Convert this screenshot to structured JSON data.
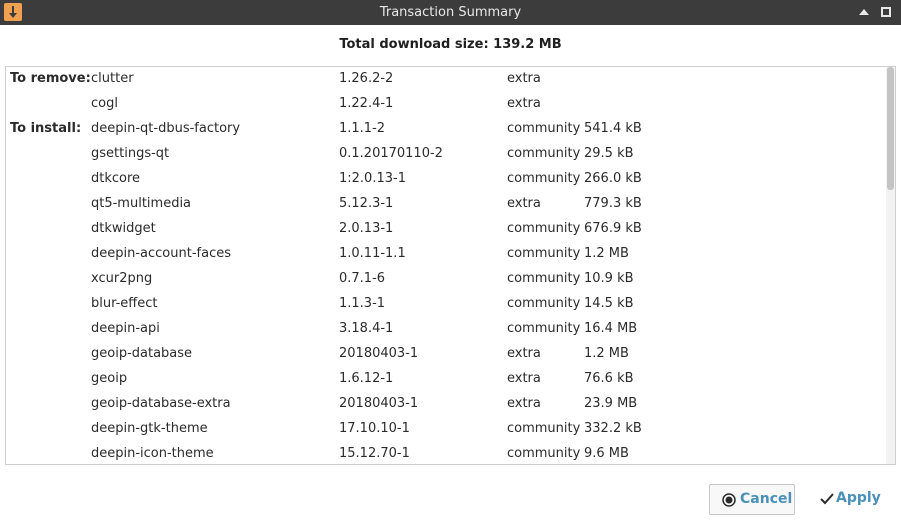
{
  "window": {
    "title": "Transaction Summary"
  },
  "summary": {
    "total_label": "Total download size: 139.2 MB"
  },
  "groups": {
    "remove": "To remove:",
    "install": "To install:"
  },
  "to_remove": [
    {
      "name": "clutter",
      "version": "1.26.2-2",
      "repo": "extra",
      "size": ""
    },
    {
      "name": "cogl",
      "version": "1.22.4-1",
      "repo": "extra",
      "size": ""
    }
  ],
  "to_install": [
    {
      "name": "deepin-qt-dbus-factory",
      "version": "1.1.1-2",
      "repo": "community",
      "size": "541.4 kB"
    },
    {
      "name": "gsettings-qt",
      "version": "0.1.20170110-2",
      "repo": "community",
      "size": "29.5 kB"
    },
    {
      "name": "dtkcore",
      "version": "1:2.0.13-1",
      "repo": "community",
      "size": "266.0 kB"
    },
    {
      "name": "qt5-multimedia",
      "version": "5.12.3-1",
      "repo": "extra",
      "size": "779.3 kB"
    },
    {
      "name": "dtkwidget",
      "version": "2.0.13-1",
      "repo": "community",
      "size": "676.9 kB"
    },
    {
      "name": "deepin-account-faces",
      "version": "1.0.11-1.1",
      "repo": "community",
      "size": "1.2 MB"
    },
    {
      "name": "xcur2png",
      "version": "0.7.1-6",
      "repo": "community",
      "size": "10.9 kB"
    },
    {
      "name": "blur-effect",
      "version": "1.1.3-1",
      "repo": "community",
      "size": "14.5 kB"
    },
    {
      "name": "deepin-api",
      "version": "3.18.4-1",
      "repo": "community",
      "size": "16.4 MB"
    },
    {
      "name": "geoip-database",
      "version": "20180403-1",
      "repo": "extra",
      "size": "1.2 MB"
    },
    {
      "name": "geoip",
      "version": "1.6.12-1",
      "repo": "extra",
      "size": "76.6 kB"
    },
    {
      "name": "geoip-database-extra",
      "version": "20180403-1",
      "repo": "extra",
      "size": "23.9 MB"
    },
    {
      "name": "deepin-gtk-theme",
      "version": "17.10.10-1",
      "repo": "community",
      "size": "332.2 kB"
    },
    {
      "name": "deepin-icon-theme",
      "version": "15.12.70-1",
      "repo": "community",
      "size": "9.6 MB"
    }
  ],
  "buttons": {
    "cancel": "Cancel",
    "apply": "Apply"
  },
  "icons": {
    "app": "download-arrow-icon",
    "maximize": "triangle-up-icon",
    "restore": "window-square-icon",
    "cancel": "cancel-circle-icon",
    "apply": "checkmark-icon"
  },
  "colors": {
    "titlebar": "#3c3c3c",
    "app_icon": "#f0a050",
    "button_text": "#4a90b8"
  }
}
